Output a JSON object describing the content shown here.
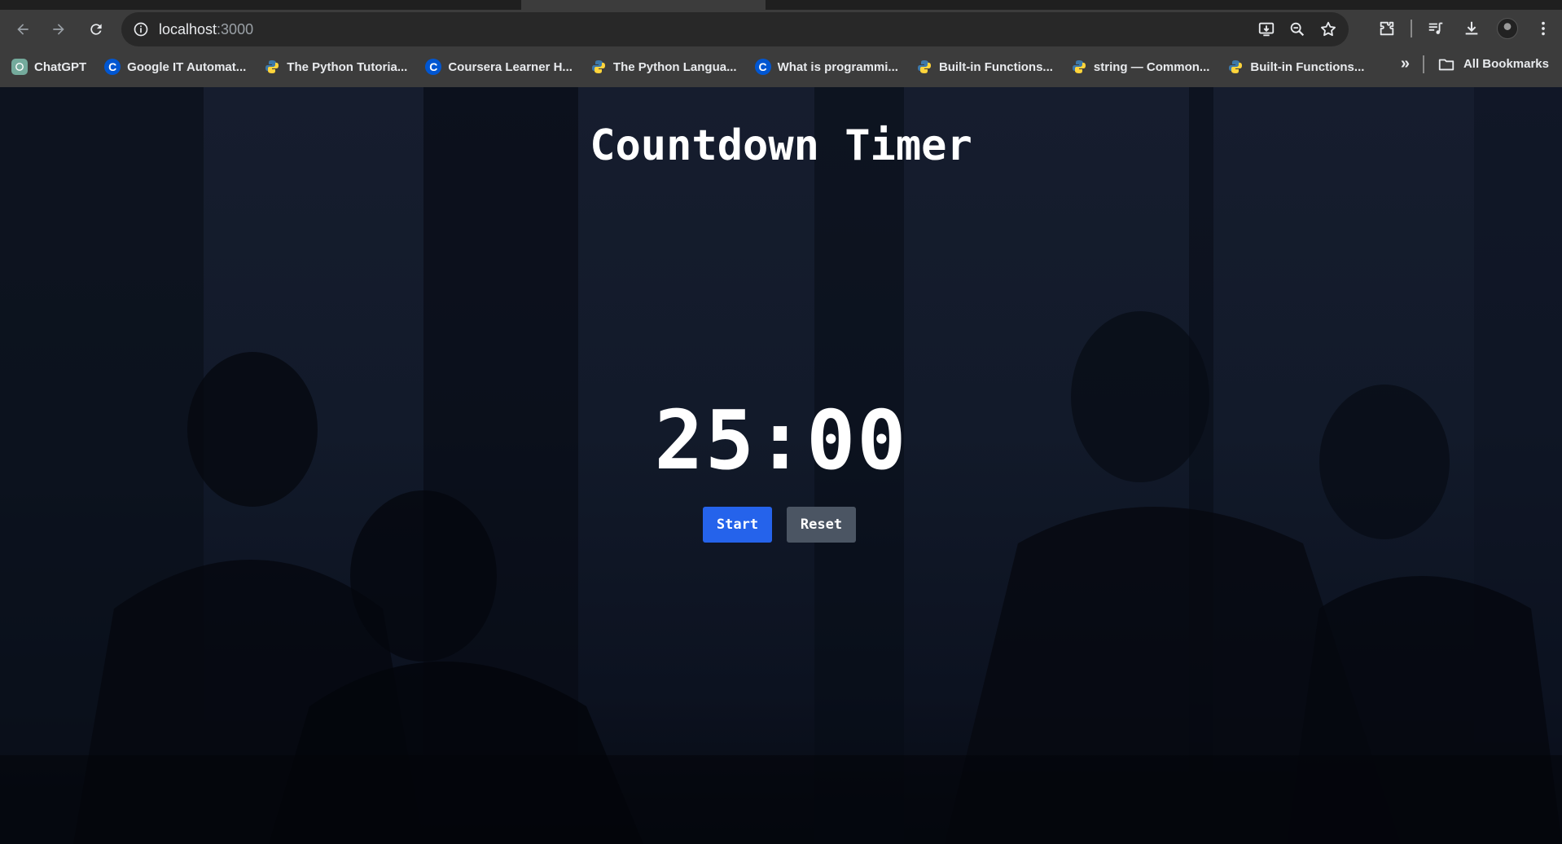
{
  "browser": {
    "url_host": "localhost",
    "url_port": ":3000",
    "bookmarks": [
      {
        "label": "ChatGPT",
        "icon": "chatgpt-icon"
      },
      {
        "label": "Google IT Automat...",
        "icon": "coursera-icon"
      },
      {
        "label": "The Python Tutoria...",
        "icon": "python-icon"
      },
      {
        "label": "Coursera Learner H...",
        "icon": "coursera-icon"
      },
      {
        "label": "The Python Langua...",
        "icon": "python-icon"
      },
      {
        "label": "What is programmi...",
        "icon": "coursera-icon"
      },
      {
        "label": "Built-in Functions...",
        "icon": "python-icon"
      },
      {
        "label": "string — Common...",
        "icon": "python-icon"
      },
      {
        "label": "Built-in Functions...",
        "icon": "python-icon"
      }
    ],
    "all_bookmarks_label": "All Bookmarks",
    "overflow_label": "»"
  },
  "app": {
    "title": "Countdown Timer",
    "time": "25:00",
    "start_label": "Start",
    "reset_label": "Reset"
  },
  "colors": {
    "start_button": "#2563eb",
    "reset_button": "#4b5563",
    "overlay": "#121a2a"
  }
}
